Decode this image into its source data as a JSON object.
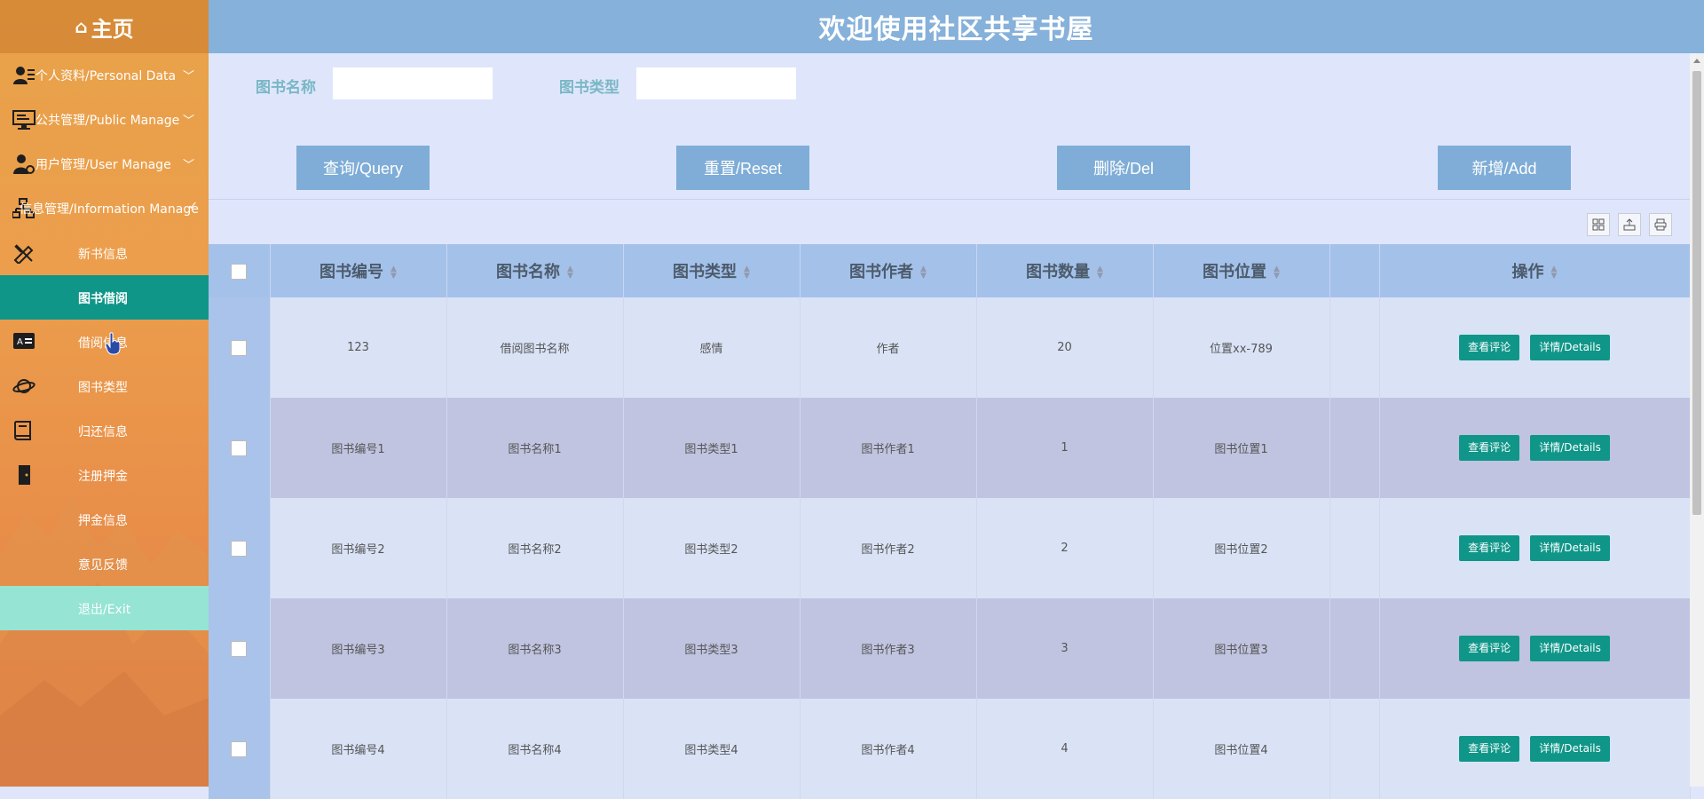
{
  "sidebar": {
    "home_label": "主页",
    "items": [
      {
        "label": "个人资料/Personal Data",
        "icon": "user-card-icon"
      },
      {
        "label": "公共管理/Public Manage",
        "icon": "monitor-icon"
      },
      {
        "label": "用户管理/User Manage",
        "icon": "user-gear-icon"
      },
      {
        "label": "信息管理/Information Manage",
        "icon": "org-chart-icon"
      }
    ],
    "subitems": [
      {
        "label": "新书信息",
        "icon": "pencil-ruler-icon"
      },
      {
        "label": "图书借阅"
      },
      {
        "label": "借阅信息",
        "icon": "translate-icon"
      },
      {
        "label": "图书类型",
        "icon": "planet-icon"
      },
      {
        "label": "归还信息",
        "icon": "book-icon"
      },
      {
        "label": "注册押金",
        "icon": "door-icon"
      },
      {
        "label": "押金信息"
      },
      {
        "label": "意见反馈"
      },
      {
        "label": "退出/Exit"
      }
    ]
  },
  "header": {
    "title": "欢迎使用社区共享书屋"
  },
  "search": {
    "name_label": "图书名称",
    "name_value": "",
    "type_label": "图书类型",
    "type_value": ""
  },
  "buttons": {
    "query": "查询/Query",
    "reset": "重置/Reset",
    "delete": "删除/Del",
    "add": "新增/Add"
  },
  "table": {
    "columns": [
      "图书编号",
      "图书名称",
      "图书类型",
      "图书作者",
      "图书数量",
      "图书位置",
      "",
      "操作"
    ],
    "rows": [
      [
        "123",
        "借阅图书名称",
        "感情",
        "作者",
        "20",
        "位置xx-789"
      ],
      [
        "图书编号1",
        "图书名称1",
        "图书类型1",
        "图书作者1",
        "1",
        "图书位置1"
      ],
      [
        "图书编号2",
        "图书名称2",
        "图书类型2",
        "图书作者2",
        "2",
        "图书位置2"
      ],
      [
        "图书编号3",
        "图书名称3",
        "图书类型3",
        "图书作者3",
        "3",
        "图书位置3"
      ],
      [
        "图书编号4",
        "图书名称4",
        "图书类型4",
        "图书作者4",
        "4",
        "图书位置4"
      ]
    ],
    "action_review": "查看评论",
    "action_details": "详情/Details"
  },
  "colors": {
    "accent_green": "#0f9688",
    "header_blue": "#86b1da",
    "button_blue": "#7fadd7",
    "sidebar_orange": "#e8a24a",
    "label_teal": "#7ab7c6"
  }
}
